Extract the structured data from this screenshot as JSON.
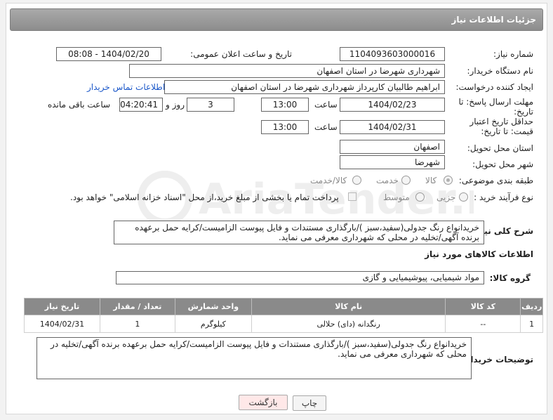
{
  "header": {
    "title": "جزئیات اطلاعات نیاز"
  },
  "labels": {
    "need_number": "شماره نیاز:",
    "announce_datetime": "تاریخ و ساعت اعلان عمومی:",
    "buyer_org": "نام دستگاه خریدار:",
    "requester": "ایجاد کننده درخواست:",
    "reply_deadline": "مهلت ارسال پاسخ: تا تاریخ:",
    "price_validity": "حداقل تاریخ اعتبار قیمت: تا تاریخ:",
    "time": "ساعت",
    "day_and": "روز و",
    "remaining": "ساعت باقی مانده",
    "province": "استان محل تحویل:",
    "city": "شهر محل تحویل:",
    "category": "طبقه بندی موضوعی:",
    "process_type": "نوع فرآیند خرید :",
    "general_desc": "شرح کلی نیاز:",
    "goods_info": "اطلاعات کالاهای مورد نیاز",
    "goods_group": "گروه کالا:",
    "buyer_notes": "توضیحات خریدار:"
  },
  "fields": {
    "need_number": "1104093603000016",
    "announce_datetime": "1404/02/20 - 08:08",
    "buyer_org": "شهرداری شهرضا در استان اصفهان",
    "requester": "ابراهیم طالبیان کارپرداز شهرداری شهرضا در استان اصفهان",
    "contact_link": "اطلاعات تماس خریدار",
    "reply_date": "1404/02/23",
    "reply_time": "13:00",
    "reply_days": "3",
    "remaining_time": "04:20:41",
    "validity_date": "1404/02/31",
    "validity_time": "13:00",
    "province": "اصفهان",
    "city": "شهرضا",
    "general_desc": "خریدانواع رنگ جدولی(سفید،سبز )/بارگذاری مستندات و فایل پیوست الزامیست/کرایه حمل برعهده برنده آگهی/تخلیه در محلی که شهرداری معرفی می نماید.",
    "goods_group": "مواد شیمیایی، پیوشیمیایی و  گازی",
    "buyer_notes": "خریدانواع رنگ جدولی(سفید،سبز )/بارگذاری مستندات و فایل پیوست الزامیست/کرایه حمل برعهده برنده آگهی/تخلیه در محلی که شهرداری معرفی می نماید."
  },
  "category_options": {
    "goods": "کالا",
    "service": "خدمت",
    "goods_service": "کالا/خدمت",
    "selected": "کالا"
  },
  "process_options": {
    "partial": "جزیی",
    "medium": "متوسط",
    "payment_note": "پرداخت تمام یا بخشی از مبلغ خرید،از محل \"اسناد خزانه اسلامی\" خواهد بود."
  },
  "table": {
    "headers": [
      "ردیف",
      "کد کالا",
      "نام کالا",
      "واحد شمارش",
      "تعداد / مقدار",
      "تاریخ نیاز"
    ],
    "rows": [
      [
        "1",
        "--",
        "رنگدانه (دای) حلالی",
        "کیلوگرم",
        "1",
        "1404/02/31"
      ]
    ]
  },
  "buttons": {
    "print": "چاپ",
    "back": "بازگشت"
  },
  "watermark": {
    "text": "AriaTender.neT"
  },
  "colors": {
    "header_bar": "#8d8d8d",
    "link": "#1a57c9",
    "back_button": "#ffe8e8"
  }
}
